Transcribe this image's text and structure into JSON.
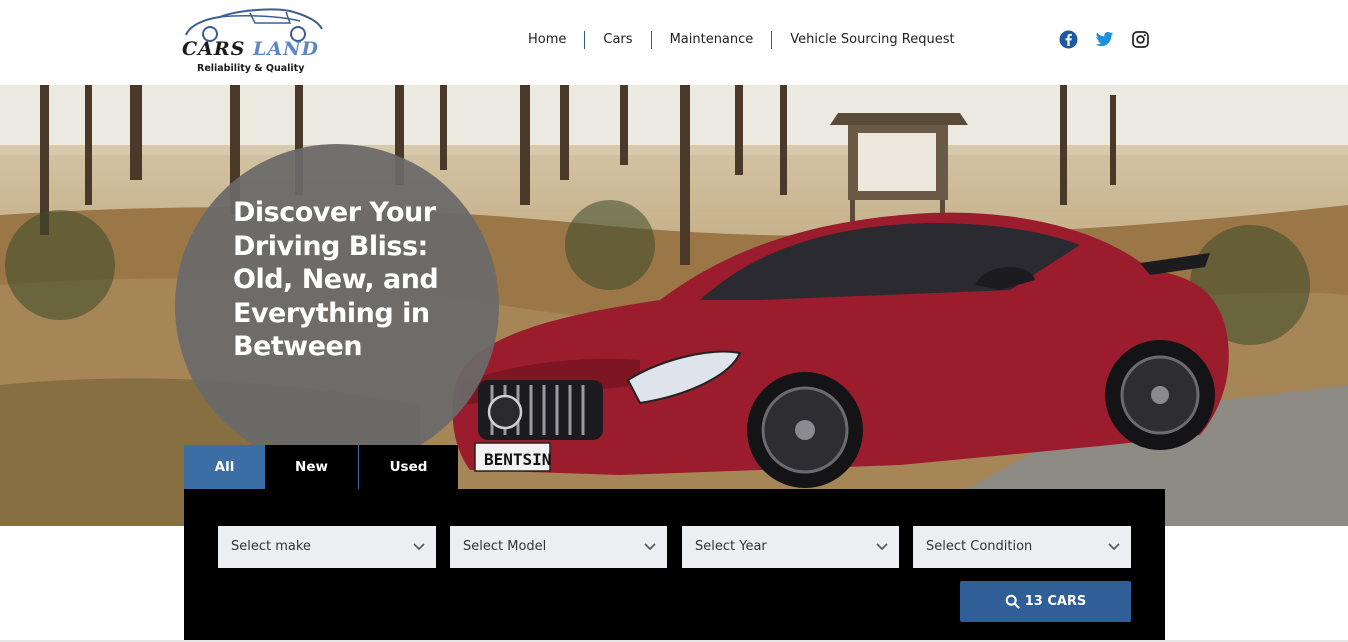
{
  "logo": {
    "name_part1": "CARS",
    "name_part2": "LAND",
    "tagline": "Reliability & Quality",
    "icon": "car-outline-icon"
  },
  "nav": {
    "items": [
      {
        "label": "Home"
      },
      {
        "label": "Cars"
      },
      {
        "label": "Maintenance"
      },
      {
        "label": "Vehicle Sourcing Request"
      }
    ]
  },
  "social": {
    "icons": [
      "facebook-icon",
      "twitter-icon",
      "instagram-icon"
    ],
    "colors": {
      "facebook": "#1e5aa0",
      "twitter": "#1d8fe0",
      "instagram": "#222222"
    }
  },
  "hero": {
    "headline": "Discover Your Driving Bliss: Old, New, and Everything in Between",
    "plate_text": "BENTSIN"
  },
  "tabs": [
    {
      "label": "All",
      "active": true
    },
    {
      "label": "New",
      "active": false
    },
    {
      "label": "Used",
      "active": false
    }
  ],
  "search": {
    "make": "Select make",
    "model": "Select Model",
    "year": "Select Year",
    "condition": "Select Condition",
    "button_label": "13 CARS",
    "button_icon": "search-icon"
  },
  "colors": {
    "accent": "#3a6ea5",
    "button": "#2f5f96",
    "panel": "#000000"
  }
}
